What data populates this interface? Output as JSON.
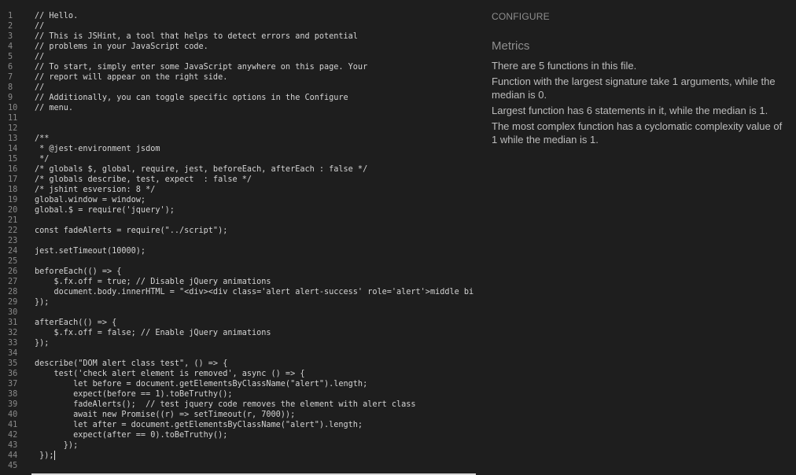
{
  "editor": {
    "lines": [
      {
        "n": "1",
        "text": "// Hello."
      },
      {
        "n": "2",
        "text": "//"
      },
      {
        "n": "3",
        "text": "// This is JSHint, a tool that helps to detect errors and potential"
      },
      {
        "n": "4",
        "text": "// problems in your JavaScript code."
      },
      {
        "n": "5",
        "text": "//"
      },
      {
        "n": "6",
        "text": "// To start, simply enter some JavaScript anywhere on this page. Your"
      },
      {
        "n": "7",
        "text": "// report will appear on the right side."
      },
      {
        "n": "8",
        "text": "//"
      },
      {
        "n": "9",
        "text": "// Additionally, you can toggle specific options in the Configure"
      },
      {
        "n": "10",
        "text": "// menu."
      },
      {
        "n": "11",
        "text": ""
      },
      {
        "n": "12",
        "text": ""
      },
      {
        "n": "13",
        "text": "/**"
      },
      {
        "n": "14",
        "text": " * @jest-environment jsdom"
      },
      {
        "n": "15",
        "text": " */"
      },
      {
        "n": "16",
        "text": "/* globals $, global, require, jest, beforeEach, afterEach : false */"
      },
      {
        "n": "17",
        "text": "/* globals describe, test, expect  : false */"
      },
      {
        "n": "18",
        "text": "/* jshint esversion: 8 */"
      },
      {
        "n": "19",
        "text": "global.window = window;"
      },
      {
        "n": "20",
        "text": "global.$ = require('jquery');"
      },
      {
        "n": "21",
        "text": ""
      },
      {
        "n": "22",
        "text": "const fadeAlerts = require(\"../script\");"
      },
      {
        "n": "23",
        "text": ""
      },
      {
        "n": "24",
        "text": "jest.setTimeout(10000);"
      },
      {
        "n": "25",
        "text": ""
      },
      {
        "n": "26",
        "text": "beforeEach(() => {"
      },
      {
        "n": "27",
        "text": "    $.fx.off = true; // Disable jQuery animations"
      },
      {
        "n": "28",
        "text": "    document.body.innerHTML = \"<div><div class='alert alert-success' role='alert'>middle bi"
      },
      {
        "n": "29",
        "text": "});"
      },
      {
        "n": "30",
        "text": ""
      },
      {
        "n": "31",
        "text": "afterEach(() => {"
      },
      {
        "n": "32",
        "text": "    $.fx.off = false; // Enable jQuery animations"
      },
      {
        "n": "33",
        "text": "});"
      },
      {
        "n": "34",
        "text": ""
      },
      {
        "n": "35",
        "text": "describe(\"DOM alert class test\", () => {"
      },
      {
        "n": "36",
        "text": "    test('check alert element is removed', async () => {"
      },
      {
        "n": "37",
        "text": "        let before = document.getElementsByClassName(\"alert\").length;"
      },
      {
        "n": "38",
        "text": "        expect(before == 1).toBeTruthy();"
      },
      {
        "n": "39",
        "text": "        fadeAlerts();  // test jquery code removes the element with alert class"
      },
      {
        "n": "40",
        "text": "        await new Promise((r) => setTimeout(r, 7000));"
      },
      {
        "n": "41",
        "text": "        let after = document.getElementsByClassName(\"alert\").length;"
      },
      {
        "n": "42",
        "text": "        expect(after == 0).toBeTruthy();"
      },
      {
        "n": "43",
        "text": "      });"
      },
      {
        "n": "44",
        "text": " });"
      },
      {
        "n": "45",
        "text": ""
      }
    ]
  },
  "panel": {
    "configure_label": "CONFIGURE",
    "metrics_title": "Metrics",
    "metrics": [
      "There are 5 functions in this file.",
      "Function with the largest signature take 1 arguments, while the median is 0.",
      "Largest function has 6 statements in it, while the median is 1.",
      "The most complex function has a cyclomatic complexity value of 1 while the median is 1."
    ]
  }
}
